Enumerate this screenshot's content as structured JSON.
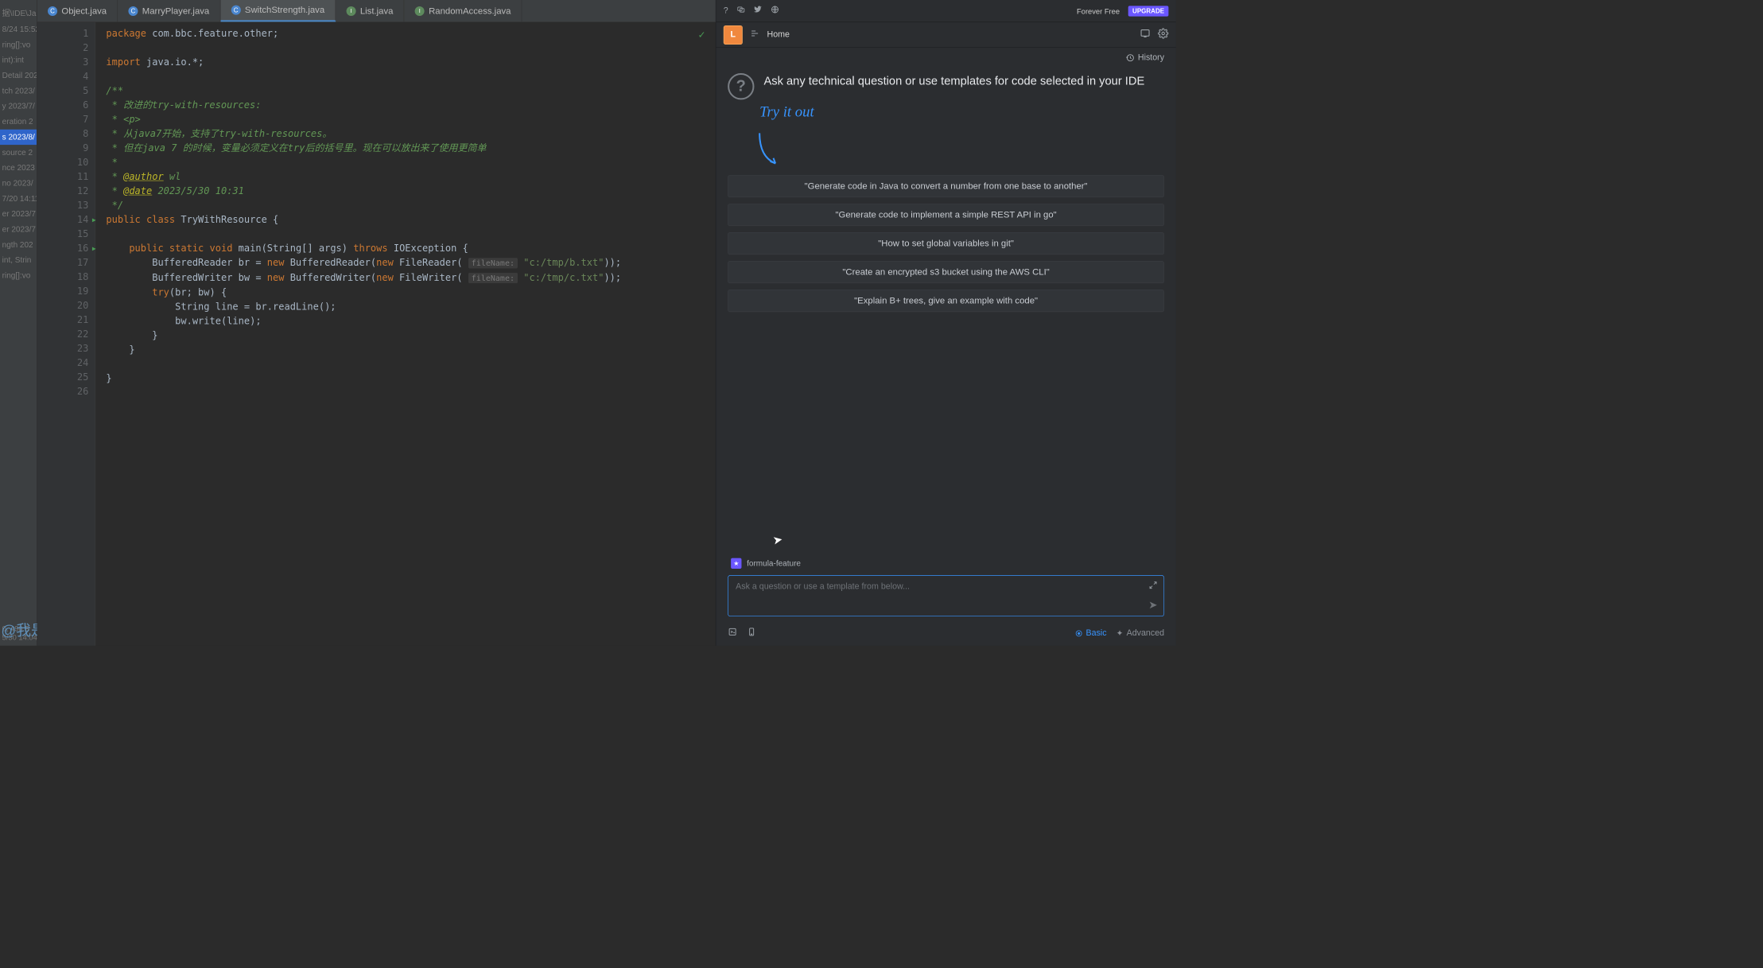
{
  "structure": {
    "path": "据\\IDE\\Ja",
    "items": [
      "8/24 15:52,",
      "ring[]:vo",
      "int):int",
      "Detail 202",
      "tch 2023/",
      "y 2023/7/",
      "eration 2",
      "s 2023/8/",
      "source 2",
      "nce 2023",
      "no 2023/",
      "7/20 14:11",
      "er 2023/7",
      "er 2023/7",
      "ngth 202",
      "int, Strin",
      "ring[]:vo"
    ],
    "selected_index": 7,
    "footer": "0, 490 B",
    "footer2": "5/30 14:04"
  },
  "watermark": "@我是男神",
  "tabs": [
    {
      "label": "Object.java",
      "icon": "c",
      "active": false
    },
    {
      "label": "MarryPlayer.java",
      "icon": "c",
      "active": false
    },
    {
      "label": "SwitchStrength.java",
      "icon": "c",
      "active": true
    },
    {
      "label": "List.java",
      "icon": "i",
      "active": false
    },
    {
      "label": "RandomAccess.java",
      "icon": "i",
      "active": false
    }
  ],
  "code": {
    "lines": [
      {
        "n": 1,
        "html": "<span class='kw'>package</span> com.bbc.feature.other;"
      },
      {
        "n": 2,
        "html": ""
      },
      {
        "n": 3,
        "html": "<span class='kw'>import</span> java.io.*;"
      },
      {
        "n": 4,
        "html": ""
      },
      {
        "n": 5,
        "html": "<span class='doc'>/**</span>"
      },
      {
        "n": 6,
        "html": "<span class='doc'> * 改进的try-with-resources:</span>"
      },
      {
        "n": 7,
        "html": "<span class='doc'> * &lt;p&gt;</span>"
      },
      {
        "n": 8,
        "html": "<span class='doc'> * 从java7开始，支持了try-with-resources。</span>"
      },
      {
        "n": 9,
        "html": "<span class='doc'> * 但在java 7 的时候，变量必须定义在try后的括号里。现在可以放出来了使用更简单</span>"
      },
      {
        "n": 10,
        "html": "<span class='doc'> *</span>"
      },
      {
        "n": 11,
        "html": "<span class='doc'> * <span class='ann'>@author</span> wl</span>"
      },
      {
        "n": 12,
        "html": "<span class='doc'> * <span class='ann'>@date</span> 2023/5/30 10:31</span>"
      },
      {
        "n": 13,
        "html": "<span class='doc'> */</span>"
      },
      {
        "n": 14,
        "html": "<span class='kw'>public class</span> TryWithResource {",
        "run": true
      },
      {
        "n": 15,
        "html": ""
      },
      {
        "n": 16,
        "html": "    <span class='kw'>public static void</span> main(String[] args) <span class='kw'>throws</span> IOException {",
        "run": true
      },
      {
        "n": 17,
        "html": "        BufferedReader br = <span class='kw'>new</span> BufferedReader(<span class='kw'>new</span> FileReader( <span class='hint'>fileName:</span> <span class='str'>\"c:/tmp/b.txt\"</span>));"
      },
      {
        "n": 18,
        "html": "        BufferedWriter bw = <span class='kw'>new</span> BufferedWriter(<span class='kw'>new</span> FileWriter( <span class='hint'>fileName:</span> <span class='str'>\"c:/tmp/c.txt\"</span>));"
      },
      {
        "n": 19,
        "html": "        <span class='kw'>try</span>(br; bw) {"
      },
      {
        "n": 20,
        "html": "            String line = br.readLine();"
      },
      {
        "n": 21,
        "html": "            bw.write(line);"
      },
      {
        "n": 22,
        "html": "        }"
      },
      {
        "n": 23,
        "html": "    }"
      },
      {
        "n": 24,
        "html": ""
      },
      {
        "n": 25,
        "html": "}"
      },
      {
        "n": 26,
        "html": ""
      }
    ]
  },
  "assistant": {
    "forever_free": "Forever Free",
    "upgrade": "UPGRADE",
    "avatar": "L",
    "home": "Home",
    "history": "History",
    "ask_heading": "Ask any technical question or use templates for code selected in your IDE",
    "try_it": "Try it out",
    "context_chip": "formula-feature",
    "suggestions": [
      "\"Generate code in Java to convert a number from one base to another\"",
      "\"Generate code to implement a simple REST API in go\"",
      "\"How to set global variables in git\"",
      "\"Create an encrypted s3 bucket using the AWS CLI\"",
      "\"Explain B+ trees, give an example with code\""
    ],
    "input_placeholder": "Ask a question or use a template from below...",
    "basic": "Basic",
    "advanced": "Advanced"
  }
}
